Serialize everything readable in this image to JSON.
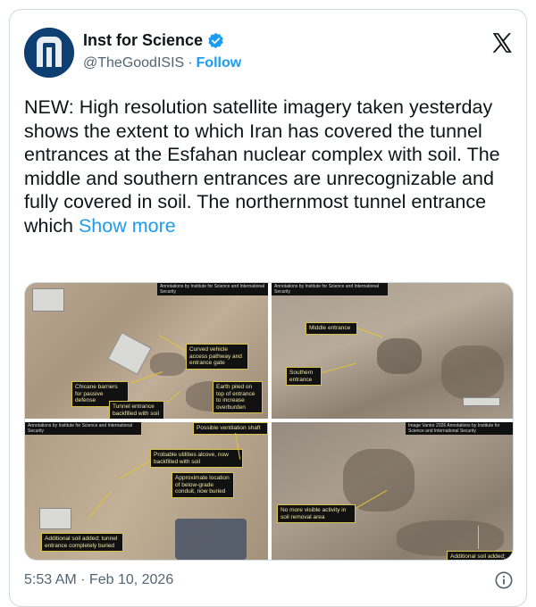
{
  "tweet": {
    "author_name": "Inst for Science",
    "handle": "@TheGoodISIS",
    "separator": "·",
    "follow_label": "Follow",
    "text": "NEW: High resolution satellite imagery taken yesterday shows the extent to which Iran has covered the tunnel entrances at the Esfahan nuclear complex with soil. The middle and southern entrances are unrecognizable and fully covered in soil. The northernmost tunnel entrance which ",
    "show_more_label": "Show more",
    "timestamp": "5:53 AM · Feb 10, 2026"
  },
  "media": {
    "panel1": {
      "attribution": "Annotations by Institute for Science and International Security",
      "labels": [
        "Curved vehicle access pathway and entrance gate",
        "Chicane barriers for passive defense",
        "Earth piled on top of entrance to increase overburden",
        "Tunnel entrance backfilled with soil"
      ]
    },
    "panel2": {
      "attribution": "Annotations by Institute for Science and International Security",
      "labels": [
        "Middle entrance",
        "Southern entrance"
      ]
    },
    "panel3": {
      "attribution": "Annotations by Institute for Science and International Security",
      "labels": [
        "Possible ventilation shaft",
        "Probable utilities alcove, now backfilled with soil",
        "Approximate location of below-grade conduit, now buried",
        "Additional soil added; tunnel entrance completely buried"
      ]
    },
    "panel4": {
      "attribution": "Image Vantor 2026 Annotations by Institute for Science and International Security",
      "labels": [
        "No more visible activity in soil removal area",
        "Additional soil added; tunnel"
      ]
    }
  },
  "icons": {
    "verified": "verified-badge-icon",
    "x_logo": "x-logo-icon",
    "info": "info-icon"
  },
  "colors": {
    "link": "#1d9bf0",
    "secondary_text": "#536471",
    "label_text": "#f1e6a8",
    "annotation_line": "#e1c534"
  }
}
